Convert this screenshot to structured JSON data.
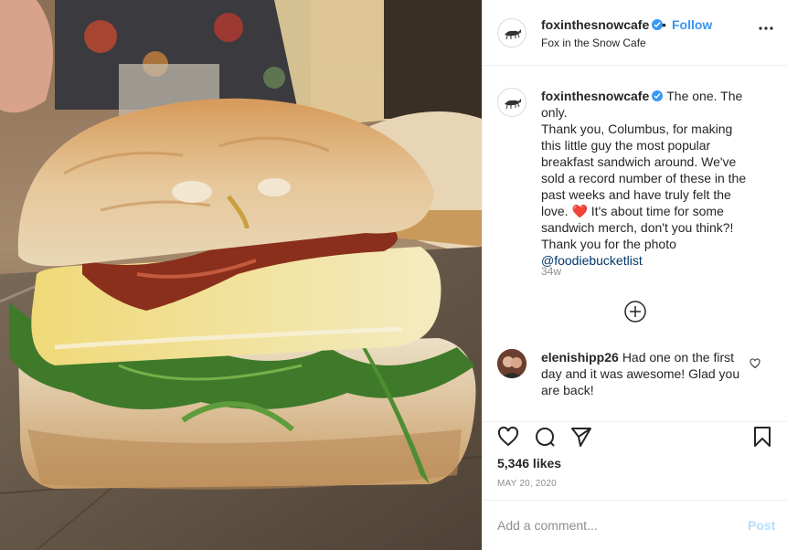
{
  "account": {
    "username": "foxinthesnowcafe",
    "verified": true,
    "follow_separator": "•",
    "follow_label": "Follow",
    "location": "Fox in the Snow Cafe"
  },
  "caption": {
    "username": "foxinthesnowcafe",
    "text": "The one. The only.\nThank you, Columbus, for making this little guy the most popular breakfast sandwich around. We've sold a record number of these in the past weeks and have truly felt the love.",
    "heart_emoji": "❤️",
    "text_after_heart": " It's about time for some sandwich merch, don't you think?! Thank you for the photo ",
    "mention": "@foodiebucketlist",
    "time_ago": "34w"
  },
  "comment": {
    "username": "elenishipp26",
    "text": "Had one on the first day and it was awesome! Glad you are back!"
  },
  "actions": {
    "icons": [
      "heart-icon",
      "comment-icon",
      "share-icon",
      "bookmark-icon"
    ],
    "likes": "5,346 likes",
    "date": "MAY 20, 2020"
  },
  "add_comment": {
    "placeholder": "Add a comment...",
    "post_label": "Post"
  },
  "colors": {
    "accent": "#3897f0",
    "post_disabled": "#b2dffc",
    "heart_emoji": "#e0244a",
    "secondary_text": "#8e8e8e"
  }
}
